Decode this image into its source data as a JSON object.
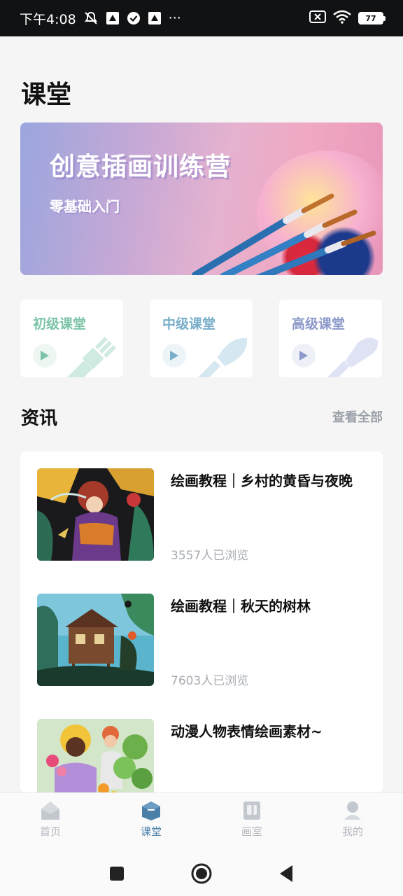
{
  "status_bar": {
    "time": "下午4:08",
    "more": "···",
    "battery": "77"
  },
  "page_title": "课堂",
  "banner": {
    "title": "创意插画训练营",
    "subtitle": "零基础入门"
  },
  "levels": [
    {
      "label": "初级课堂",
      "color": "#7dc4a7",
      "accent_bg": "#eef6f2",
      "deco_color": "#cfeae0"
    },
    {
      "label": "中级课堂",
      "color": "#79aec9",
      "accent_bg": "#edf4f8",
      "deco_color": "#d5e7f0"
    },
    {
      "label": "高级课堂",
      "color": "#8c99c9",
      "accent_bg": "#eef0f8",
      "deco_color": "#dfe3f3"
    }
  ],
  "news": {
    "title": "资讯",
    "view_all": "查看全部",
    "items": [
      {
        "headline": "绘画教程｜乡村的黄昏与夜晚",
        "views": "3557人已浏览"
      },
      {
        "headline": "绘画教程｜秋天的树林",
        "views": "7603人已浏览"
      },
      {
        "headline": "动漫人物表情绘画素材~",
        "views": ""
      }
    ]
  },
  "bottom_nav": {
    "items": [
      {
        "label": "首页",
        "icon": "home-icon"
      },
      {
        "label": "课堂",
        "icon": "classroom-icon",
        "active": true
      },
      {
        "label": "画室",
        "icon": "studio-icon"
      },
      {
        "label": "我的",
        "icon": "profile-icon"
      }
    ],
    "active_color": "#4a7fa8",
    "inactive_color": "#b3b7bd"
  }
}
